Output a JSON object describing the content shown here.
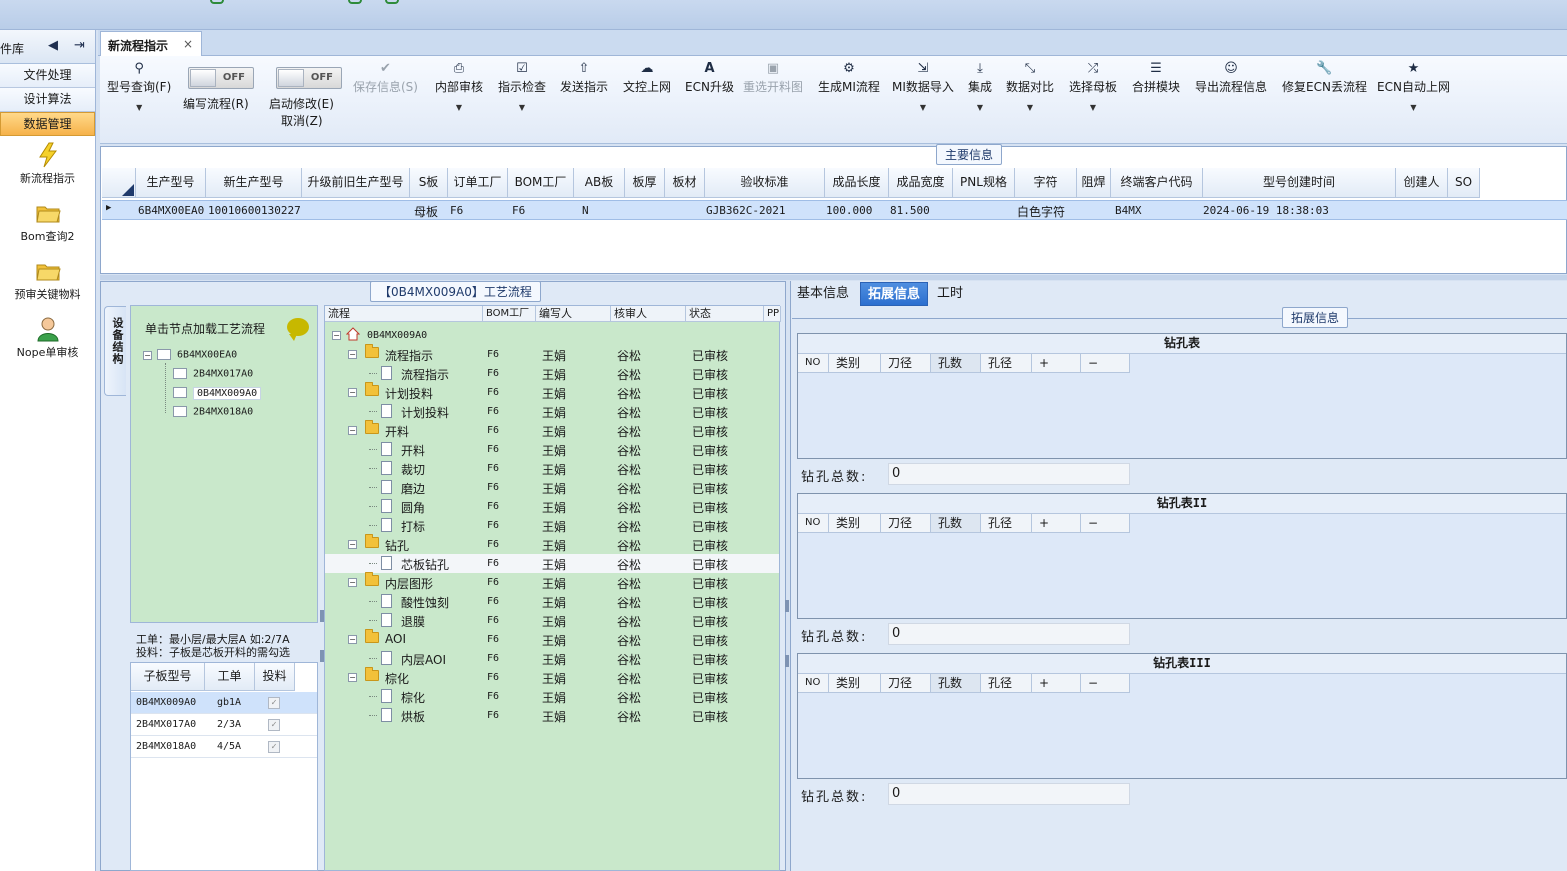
{
  "left_nav": {
    "header_label": "件库",
    "groups": [
      "文件处理",
      "设计算法",
      "数据管理"
    ],
    "items": [
      "新流程指示",
      "Bom查询2",
      "预审关键物料",
      "Nope单审核"
    ]
  },
  "doc_tab": {
    "label": "新流程指示",
    "close": "×"
  },
  "ribbon": {
    "toggle_off": "OFF",
    "buttons": [
      {
        "label": "型号查询(F)",
        "icon": "search-icon"
      },
      {
        "label": "编写流程(R)",
        "icon": "toggle"
      },
      {
        "label": "启动修改(E)",
        "label2": "取消(Z)",
        "icon": "toggle"
      },
      {
        "label": "保存信息(S)",
        "icon": "check-icon"
      },
      {
        "label": "内部审核",
        "icon": "printer-icon"
      },
      {
        "label": "指示检查",
        "icon": "checkbox-icon"
      },
      {
        "label": "发送指示",
        "icon": "upload-icon"
      },
      {
        "label": "文控上网",
        "icon": "cloud-upload-icon"
      },
      {
        "label": "ECN升级",
        "icon": "font-icon"
      },
      {
        "label": "重选开料图",
        "icon": "image-icon"
      },
      {
        "label": "生成MI流程",
        "icon": "cogs-icon"
      },
      {
        "label": "MI数据导入",
        "icon": "import-icon"
      },
      {
        "label": "集成",
        "icon": "download-icon"
      },
      {
        "label": "数据对比",
        "icon": "compress-icon"
      },
      {
        "label": "选择母板",
        "icon": "shuffle-icon"
      },
      {
        "label": "合拼模块",
        "icon": "list-icon"
      },
      {
        "label": "导出流程信息",
        "icon": "smile-icon"
      },
      {
        "label": "修复ECN丢流程",
        "icon": "wrench-icon"
      },
      {
        "label": "ECN自动上网",
        "icon": "star-icon"
      }
    ]
  },
  "main_info": {
    "title": "主要信息",
    "columns": [
      "生产型号",
      "新生产型号",
      "升级前旧生产型号",
      "S板",
      "订单工厂",
      "BOM工厂",
      "AB板",
      "板厚",
      "板材",
      "验收标准",
      "成品长度",
      "成品宽度",
      "PNL规格",
      "字符",
      "阻焊",
      "终端客户代码",
      "型号创建时间",
      "创建人",
      "SO"
    ],
    "row": [
      "6B4MX00EA0",
      "10010600130227",
      "",
      "母板",
      "F6",
      "F6",
      "N",
      "",
      "",
      "GJB362C-2021",
      "100.000",
      "81.500",
      "",
      "白色字符",
      "",
      "B4MX",
      "2024-06-19 18:38:03",
      "",
      ""
    ]
  },
  "process": {
    "title": "【0B4MX009A0】工艺流程",
    "vertical_tab": "设备结构",
    "tree_hint": "单击节点加载工艺流程",
    "tree": [
      "6B4MX00EA0",
      "2B4MX017A0",
      "0B4MX009A0",
      "2B4MX018A0"
    ],
    "hint1": "工单：最小层/最大层A 如:2/7A",
    "hint2": "投料：子板是芯板开料的需勾选",
    "sub_columns": [
      "子板型号",
      "工单",
      "投料"
    ],
    "sub_rows": [
      {
        "model": "0B4MX009A0",
        "order": "gb1A",
        "checked": true
      },
      {
        "model": "2B4MX017A0",
        "order": "2/3A",
        "checked": true
      },
      {
        "model": "2B4MX018A0",
        "order": "4/5A",
        "checked": true
      }
    ],
    "grid_columns": [
      "流程",
      "BOM工厂",
      "编写人",
      "核审人",
      "状态",
      "PP"
    ],
    "root": "0B4MX009A0",
    "rows": [
      {
        "name": "流程指示",
        "level": 1,
        "bom": "F6",
        "writer": "王娟",
        "reviewer": "谷松",
        "status": "已审核"
      },
      {
        "name": "流程指示",
        "level": 2,
        "bom": "F6",
        "writer": "王娟",
        "reviewer": "谷松",
        "status": "已审核"
      },
      {
        "name": "计划投料",
        "level": 1,
        "bom": "F6",
        "writer": "王娟",
        "reviewer": "谷松",
        "status": "已审核"
      },
      {
        "name": "计划投料",
        "level": 2,
        "bom": "F6",
        "writer": "王娟",
        "reviewer": "谷松",
        "status": "已审核"
      },
      {
        "name": "开料",
        "level": 1,
        "bom": "F6",
        "writer": "王娟",
        "reviewer": "谷松",
        "status": "已审核"
      },
      {
        "name": "开料",
        "level": 2,
        "bom": "F6",
        "writer": "王娟",
        "reviewer": "谷松",
        "status": "已审核"
      },
      {
        "name": "裁切",
        "level": 2,
        "bom": "F6",
        "writer": "王娟",
        "reviewer": "谷松",
        "status": "已审核"
      },
      {
        "name": "磨边",
        "level": 2,
        "bom": "F6",
        "writer": "王娟",
        "reviewer": "谷松",
        "status": "已审核"
      },
      {
        "name": "圆角",
        "level": 2,
        "bom": "F6",
        "writer": "王娟",
        "reviewer": "谷松",
        "status": "已审核"
      },
      {
        "name": "打标",
        "level": 2,
        "bom": "F6",
        "writer": "王娟",
        "reviewer": "谷松",
        "status": "已审核"
      },
      {
        "name": "钻孔",
        "level": 1,
        "bom": "F6",
        "writer": "王娟",
        "reviewer": "谷松",
        "status": "已审核"
      },
      {
        "name": "芯板钻孔",
        "level": 2,
        "bom": "F6",
        "writer": "王娟",
        "reviewer": "谷松",
        "status": "已审核"
      },
      {
        "name": "内层图形",
        "level": 1,
        "bom": "F6",
        "writer": "王娟",
        "reviewer": "谷松",
        "status": "已审核"
      },
      {
        "name": "酸性蚀刻",
        "level": 2,
        "bom": "F6",
        "writer": "王娟",
        "reviewer": "谷松",
        "status": "已审核"
      },
      {
        "name": "退膜",
        "level": 2,
        "bom": "F6",
        "writer": "王娟",
        "reviewer": "谷松",
        "status": "已审核"
      },
      {
        "name": "AOI",
        "level": 1,
        "bom": "F6",
        "writer": "王娟",
        "reviewer": "谷松",
        "status": "已审核"
      },
      {
        "name": "内层AOI",
        "level": 2,
        "bom": "F6",
        "writer": "王娟",
        "reviewer": "谷松",
        "status": "已审核"
      },
      {
        "name": "棕化",
        "level": 1,
        "bom": "F6",
        "writer": "王娟",
        "reviewer": "谷松",
        "status": "已审核"
      },
      {
        "name": "棕化",
        "level": 2,
        "bom": "F6",
        "writer": "王娟",
        "reviewer": "谷松",
        "status": "已审核"
      },
      {
        "name": "烘板",
        "level": 2,
        "bom": "F6",
        "writer": "王娟",
        "reviewer": "谷松",
        "status": "已审核"
      }
    ]
  },
  "right": {
    "tabs": [
      "基本信息",
      "拓展信息",
      "工时"
    ],
    "active_tab": "拓展信息",
    "ext_title": "拓展信息",
    "drill_columns": [
      "NO",
      "类别",
      "刀径",
      "孔数",
      "孔径",
      "+",
      "−"
    ],
    "total_label": "钻孔总数:",
    "sections": [
      {
        "title": "钻孔表",
        "total": "0"
      },
      {
        "title": "钻孔表II",
        "total": "0"
      },
      {
        "title": "钻孔表III",
        "total": "0"
      }
    ]
  }
}
